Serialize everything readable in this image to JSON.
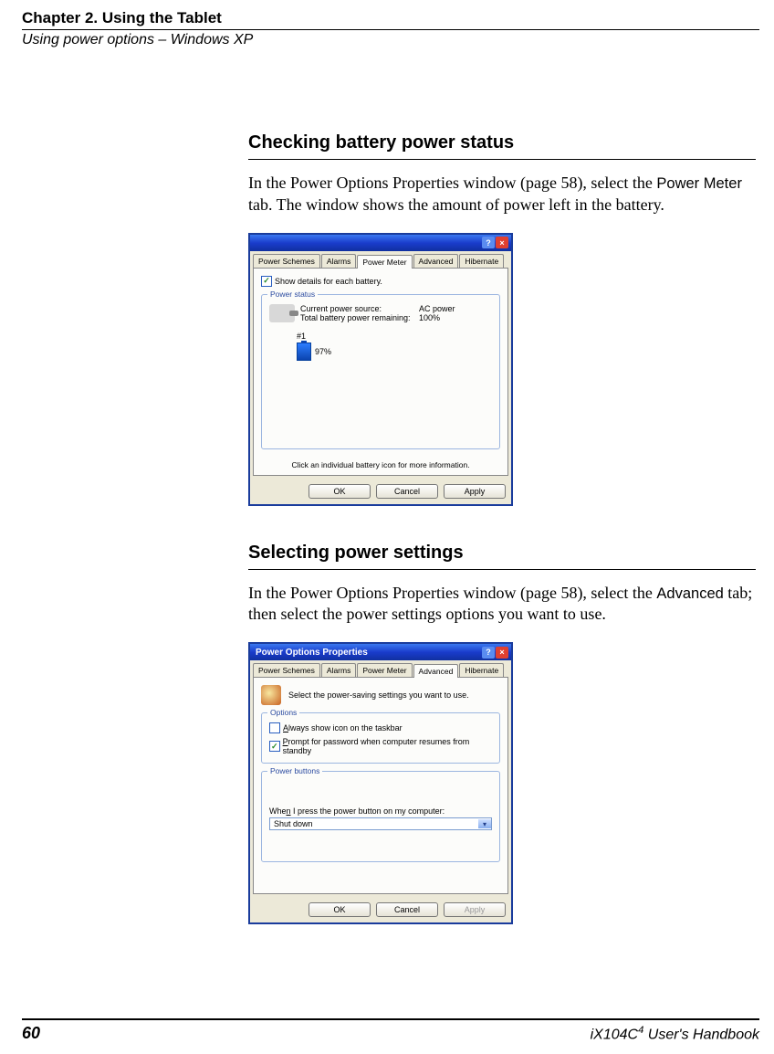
{
  "header": {
    "chapter": "Chapter 2. Using the Tablet",
    "section": "Using power options – Windows XP"
  },
  "section1": {
    "title": "Checking battery power status",
    "para_a": "In the Power Options Properties window (page 58), select the ",
    "para_b_sans": "Power Meter",
    "para_c": " tab. The window shows the amount of power left in the battery."
  },
  "dialog1": {
    "tabs": [
      "Power Schemes",
      "Alarms",
      "Power Meter",
      "Advanced",
      "Hibernate"
    ],
    "active_tab": "Power Meter",
    "show_details": "Show details for each battery.",
    "group_label": "Power status",
    "row1_label": "Current power source:",
    "row1_value": "AC power",
    "row2_label": "Total battery power remaining:",
    "row2_value": "100%",
    "batt_num": "#1",
    "batt_pct": "97%",
    "hint": "Click an individual battery icon for more information.",
    "buttons": {
      "ok": "OK",
      "cancel": "Cancel",
      "apply": "Apply"
    }
  },
  "section2": {
    "title": "Selecting power settings",
    "para_a": "In the Power Options Properties window (page 58), select the ",
    "para_b_sans": "Advanced",
    "para_c": " tab; then select the power settings options you want to use."
  },
  "dialog2": {
    "title": "Power Options Properties",
    "tabs": [
      "Power Schemes",
      "Alarms",
      "Power Meter",
      "Advanced",
      "Hibernate"
    ],
    "active_tab": "Advanced",
    "intro": "Select the power-saving settings you want to use.",
    "options_label": "Options",
    "opt1": "Always show icon on the taskbar",
    "opt2": "Prompt for password when computer resumes from standby",
    "pwrbtn_label": "Power buttons",
    "pwrbtn_prompt": "When I press the power button on my computer:",
    "pwrbtn_value": "Shut down",
    "buttons": {
      "ok": "OK",
      "cancel": "Cancel",
      "apply": "Apply"
    }
  },
  "footer": {
    "page": "60",
    "book_pre": "iX104C",
    "book_sup": "4",
    "book_post": " User's Handbook"
  }
}
